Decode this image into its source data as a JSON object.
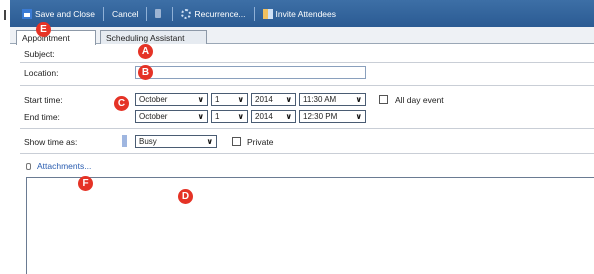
{
  "toolbar": {
    "save_close": "Save and Close",
    "cancel": "Cancel",
    "recurrence": "Recurrence...",
    "invite": "Invite Attendees"
  },
  "tabs": [
    {
      "label": "Appointment",
      "active": true
    },
    {
      "label": "Scheduling Assistant",
      "active": false
    }
  ],
  "form": {
    "subject_label": "Subject:",
    "location_label": "Location:",
    "start_label": "Start time:",
    "end_label": "End time:",
    "start": {
      "month": "October",
      "day": "1",
      "year": "2014",
      "time": "11:30 AM"
    },
    "end": {
      "month": "October",
      "day": "1",
      "year": "2014",
      "time": "12:30 PM"
    },
    "all_day_label": "All day event",
    "show_as_label": "Show time as:",
    "show_as_value": "Busy",
    "private_label": "Private",
    "attachments_label": "Attachments..."
  },
  "markers": {
    "a": "A",
    "b": "B",
    "c": "C",
    "d": "D",
    "e": "E",
    "f": "F"
  },
  "colors": {
    "toolbar": "#2f5f96",
    "marker": "#e53326",
    "link": "#2a5db0"
  }
}
